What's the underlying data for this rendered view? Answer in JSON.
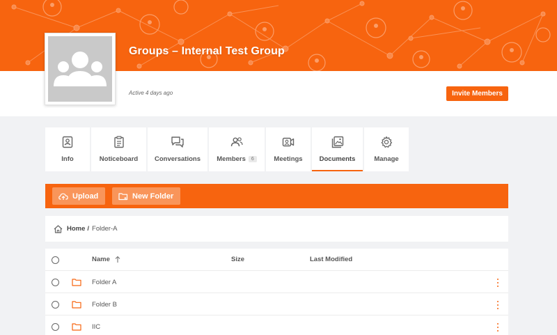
{
  "group": {
    "title": "Groups – Internal Test Group",
    "active": "Active 4 days ago",
    "invite_label": "Invite Members"
  },
  "tabs": [
    {
      "label": "Info",
      "icon": "id-card-icon"
    },
    {
      "label": "Noticeboard",
      "icon": "clipboard-icon"
    },
    {
      "label": "Conversations",
      "icon": "chat-bubbles-icon"
    },
    {
      "label": "Members",
      "icon": "users-icon",
      "count": "6"
    },
    {
      "label": "Meetings",
      "icon": "video-camera-icon"
    },
    {
      "label": "Documents",
      "icon": "image-stack-icon",
      "active": true
    },
    {
      "label": "Manage",
      "icon": "gear-icon"
    }
  ],
  "actions": {
    "upload_label": "Upload",
    "new_folder_label": "New Folder"
  },
  "breadcrumb": {
    "home": "Home",
    "separator": "/",
    "current": "Folder-A"
  },
  "table": {
    "columns": {
      "name": "Name",
      "size": "Size",
      "modified": "Last Modified"
    },
    "rows": [
      {
        "name": "Folder A",
        "size": "",
        "modified": ""
      },
      {
        "name": "Folder B",
        "size": "",
        "modified": ""
      },
      {
        "name": "IIC",
        "size": "",
        "modified": ""
      }
    ]
  },
  "colors": {
    "accent": "#f7640f",
    "accent_light": "#f9955a",
    "background": "#f1f2f4"
  }
}
